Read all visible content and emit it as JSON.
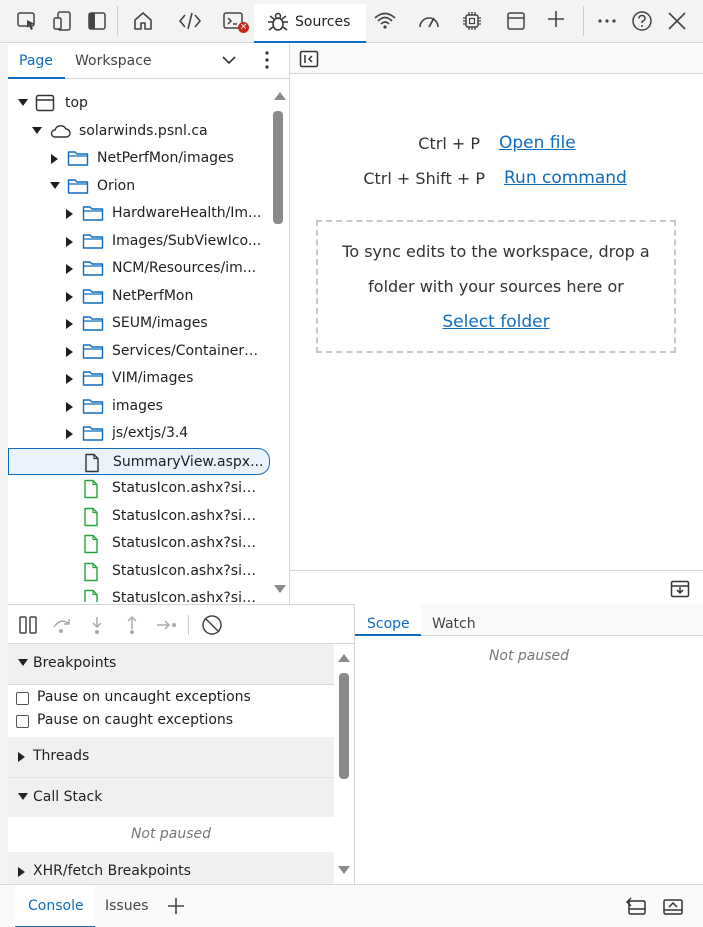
{
  "toolbar": {
    "tabs": [
      {
        "label": "Sources",
        "icon": "bug-icon"
      }
    ],
    "icons": [
      "inspect-element-icon",
      "device-emulation-icon",
      "toggle-sidebar-icon",
      "home-icon",
      "elements-icon",
      "console-icon",
      "sources-icon",
      "network-icon",
      "performance-icon",
      "memory-icon",
      "application-icon",
      "add-tab-icon",
      "more-icon",
      "help-icon",
      "close-icon"
    ],
    "error_badge_color": "#c42b1c",
    "accent": "#0f6cbd"
  },
  "navigator": {
    "tabs": [
      "Page",
      "Workspace"
    ],
    "active_tab": "Page",
    "tree": [
      {
        "label": "top",
        "level": 0,
        "expanded": true,
        "icon": "frame-icon"
      },
      {
        "label": "solarwinds.psnl.ca",
        "level": 1,
        "expanded": true,
        "icon": "cloud-icon"
      },
      {
        "label": "NetPerfMon/images",
        "level": 2,
        "expanded": false,
        "icon": "folder-icon"
      },
      {
        "label": "Orion",
        "level": 2,
        "expanded": true,
        "icon": "folder-icon"
      },
      {
        "label": "HardwareHealth/Im...",
        "level": 3,
        "expanded": false,
        "icon": "folder-icon"
      },
      {
        "label": "Images/SubViewIco...",
        "level": 3,
        "expanded": false,
        "icon": "folder-icon"
      },
      {
        "label": "NCM/Resources/im...",
        "level": 3,
        "expanded": false,
        "icon": "folder-icon"
      },
      {
        "label": "NetPerfMon",
        "level": 3,
        "expanded": false,
        "icon": "folder-icon"
      },
      {
        "label": "SEUM/images",
        "level": 3,
        "expanded": false,
        "icon": "folder-icon"
      },
      {
        "label": "Services/Containers...",
        "level": 3,
        "expanded": false,
        "icon": "folder-icon"
      },
      {
        "label": "VIM/images",
        "level": 3,
        "expanded": false,
        "icon": "folder-icon"
      },
      {
        "label": "images",
        "level": 3,
        "expanded": false,
        "icon": "folder-icon"
      },
      {
        "label": "js/extjs/3.4",
        "level": 3,
        "expanded": false,
        "icon": "folder-icon"
      },
      {
        "label": "SummaryView.aspx...",
        "level": 3,
        "selected": true,
        "icon": "document-icon"
      },
      {
        "label": "StatusIcon.ashx?size...",
        "level": 3,
        "icon": "file-green-icon"
      },
      {
        "label": "StatusIcon.ashx?size...",
        "level": 3,
        "icon": "file-green-icon"
      },
      {
        "label": "StatusIcon.ashx?size...",
        "level": 3,
        "icon": "file-green-icon"
      },
      {
        "label": "StatusIcon.ashx?size...",
        "level": 3,
        "icon": "file-green-icon"
      },
      {
        "label": "StatusIcon.ashx?size...",
        "level": 3,
        "icon": "file-green-icon"
      }
    ]
  },
  "editor": {
    "shortcuts": [
      {
        "keys": "Ctrl + P",
        "action": "Open file"
      },
      {
        "keys": "Ctrl + Shift + P",
        "action": "Run command"
      }
    ],
    "drop_text_1": "To sync edits to the workspace, drop a",
    "drop_text_2": "folder with your sources here or",
    "select_folder": "Select folder"
  },
  "debugger": {
    "sections": {
      "breakpoints": "Breakpoints",
      "threads": "Threads",
      "call_stack": "Call Stack",
      "xhr": "XHR/fetch Breakpoints"
    },
    "checkboxes": [
      "Pause on uncaught exceptions",
      "Pause on caught exceptions"
    ],
    "call_stack_status": "Not paused"
  },
  "scope": {
    "tabs": [
      "Scope",
      "Watch"
    ],
    "active_tab": "Scope",
    "status": "Not paused"
  },
  "drawer": {
    "tabs": [
      "Console",
      "Issues"
    ],
    "active_tab": "Console"
  }
}
